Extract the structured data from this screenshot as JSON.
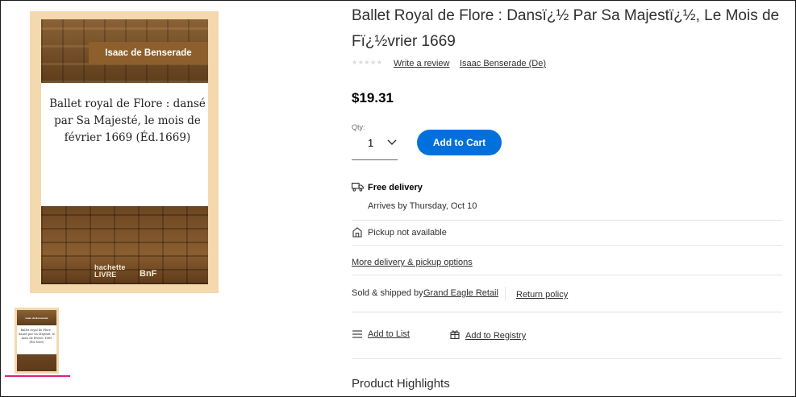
{
  "product": {
    "title": "Ballet Royal de Flore : Dansï¿½ Par Sa Majestï¿½, Le Mois de Fï¿½vrier 1669",
    "rating_stars": "★★★★★",
    "write_review": "Write a review",
    "author_link": "Isaac Benserade (De)",
    "price": "$19.31"
  },
  "cover": {
    "author": "Isaac de Benserade",
    "title": "Ballet royal de Flore : dansé par Sa Majesté, le mois de février 1669 (Éd.1669)",
    "publisher_line1": "hachette",
    "publisher_line2": "LIVRE",
    "bnf": "BnF"
  },
  "purchase": {
    "qty_label": "Qty:",
    "qty_value": "1",
    "add_to_cart": "Add to Cart",
    "accent_color": "#0071dc"
  },
  "fulfillment": {
    "free_delivery": "Free delivery",
    "arrives": "Arrives by Thursday, Oct 10",
    "pickup": "Pickup not available",
    "more_options": "More delivery & pickup options"
  },
  "seller": {
    "sold_by": "Sold & shipped by",
    "seller_name": "Grand Eagle Retail",
    "return_policy": "Return policy"
  },
  "actions": {
    "add_list": "Add to List",
    "add_registry": "Add to Registry"
  },
  "sections": {
    "highlights": "Product Highlights"
  },
  "icons": [
    "truck-icon",
    "store-icon",
    "list-icon",
    "gift-icon",
    "chevron-down-icon"
  ],
  "thumbnail_indicator_color": "#e0207a"
}
